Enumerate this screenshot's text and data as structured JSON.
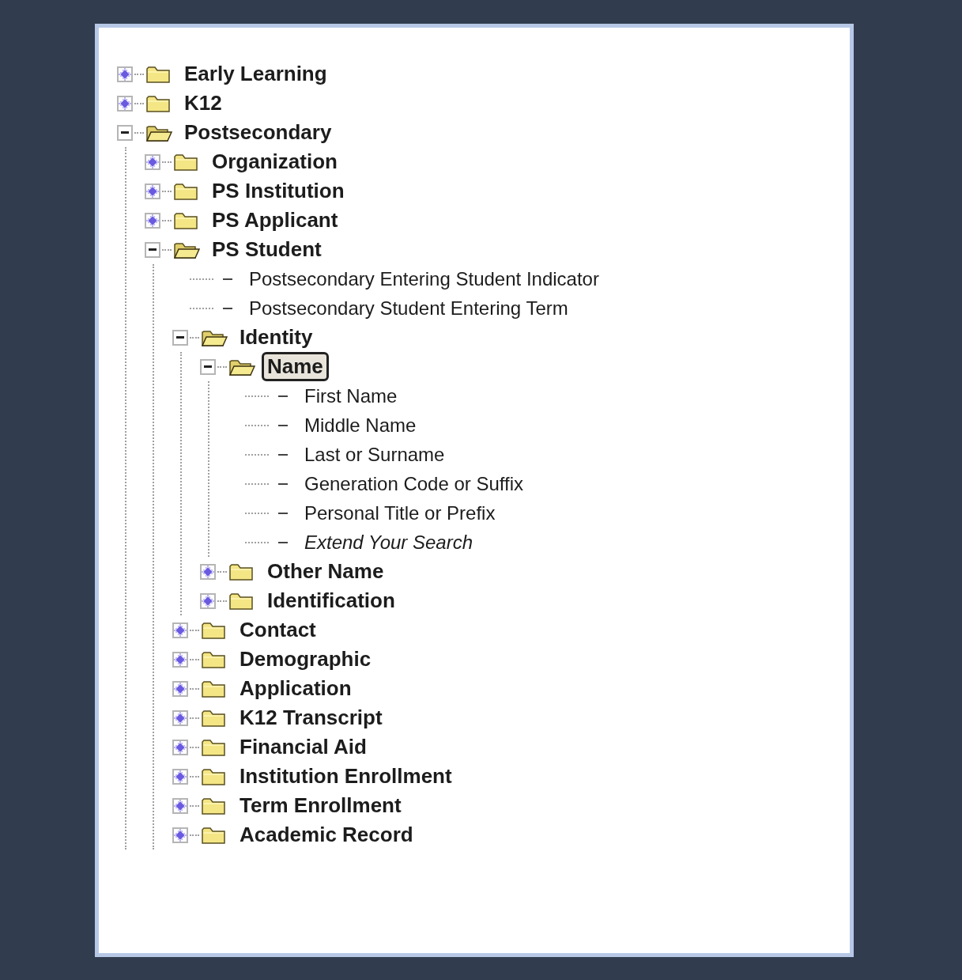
{
  "tree": [
    {
      "label": "Early Learning",
      "kind": "folder",
      "expanded": false,
      "selected": false
    },
    {
      "label": "K12",
      "kind": "folder",
      "expanded": false,
      "selected": false
    },
    {
      "label": "Postsecondary",
      "kind": "folder",
      "expanded": true,
      "selected": false,
      "children": [
        {
          "label": "Organization",
          "kind": "folder",
          "expanded": false,
          "selected": false
        },
        {
          "label": "PS Institution",
          "kind": "folder",
          "expanded": false,
          "selected": false
        },
        {
          "label": "PS Applicant",
          "kind": "folder",
          "expanded": false,
          "selected": false
        },
        {
          "label": "PS Student",
          "kind": "folder",
          "expanded": true,
          "selected": false,
          "children": [
            {
              "label": "Postsecondary Entering Student Indicator",
              "kind": "field",
              "selected": false
            },
            {
              "label": "Postsecondary Student Entering Term",
              "kind": "field",
              "selected": false
            },
            {
              "label": "Identity",
              "kind": "folder",
              "expanded": true,
              "selected": false,
              "children": [
                {
                  "label": "Name",
                  "kind": "folder",
                  "expanded": true,
                  "selected": true,
                  "children": [
                    {
                      "label": "First Name",
                      "kind": "field",
                      "selected": false
                    },
                    {
                      "label": "Middle Name",
                      "kind": "field",
                      "selected": false
                    },
                    {
                      "label": "Last or Surname",
                      "kind": "field",
                      "selected": false
                    },
                    {
                      "label": "Generation Code or Suffix",
                      "kind": "field",
                      "selected": false
                    },
                    {
                      "label": "Personal Title or Prefix",
                      "kind": "field",
                      "selected": false
                    },
                    {
                      "label": "Extend Your Search",
                      "kind": "action",
                      "selected": false
                    }
                  ]
                },
                {
                  "label": "Other Name",
                  "kind": "folder",
                  "expanded": false,
                  "selected": false
                },
                {
                  "label": "Identification",
                  "kind": "folder",
                  "expanded": false,
                  "selected": false
                }
              ]
            },
            {
              "label": "Contact",
              "kind": "folder",
              "expanded": false,
              "selected": false
            },
            {
              "label": "Demographic",
              "kind": "folder",
              "expanded": false,
              "selected": false
            },
            {
              "label": "Application",
              "kind": "folder",
              "expanded": false,
              "selected": false
            },
            {
              "label": "K12 Transcript",
              "kind": "folder",
              "expanded": false,
              "selected": false
            },
            {
              "label": "Financial Aid",
              "kind": "folder",
              "expanded": false,
              "selected": false
            },
            {
              "label": "Institution Enrollment",
              "kind": "folder",
              "expanded": false,
              "selected": false
            },
            {
              "label": "Term Enrollment",
              "kind": "folder",
              "expanded": false,
              "selected": false
            },
            {
              "label": "Academic Record",
              "kind": "folder",
              "expanded": false,
              "selected": false
            }
          ]
        }
      ]
    }
  ]
}
